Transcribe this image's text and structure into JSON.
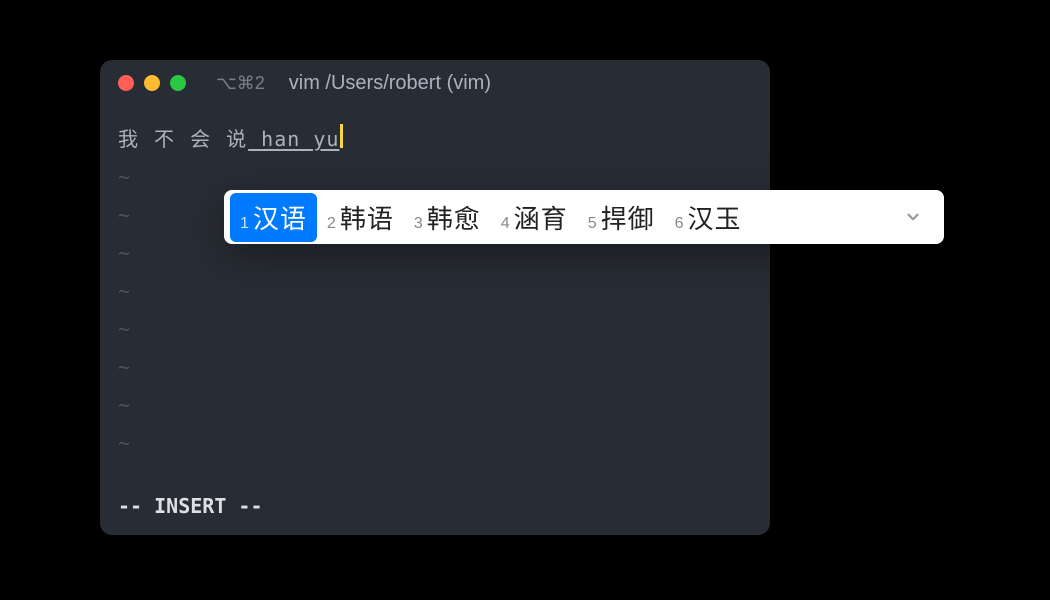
{
  "titlebar": {
    "shortcut": "⌥⌘2",
    "title": "vim /Users/robert (vim)"
  },
  "editor": {
    "prefix_text": "我 不 会 说",
    "composing_text": " han yu",
    "tilde": "~",
    "status": "-- INSERT --"
  },
  "ime": {
    "candidates": [
      {
        "num": "1",
        "text": "汉语",
        "selected": true
      },
      {
        "num": "2",
        "text": "韩语",
        "selected": false
      },
      {
        "num": "3",
        "text": "韩愈",
        "selected": false
      },
      {
        "num": "4",
        "text": "涵育",
        "selected": false
      },
      {
        "num": "5",
        "text": "捍御",
        "selected": false
      },
      {
        "num": "6",
        "text": "汉玉",
        "selected": false
      }
    ]
  }
}
